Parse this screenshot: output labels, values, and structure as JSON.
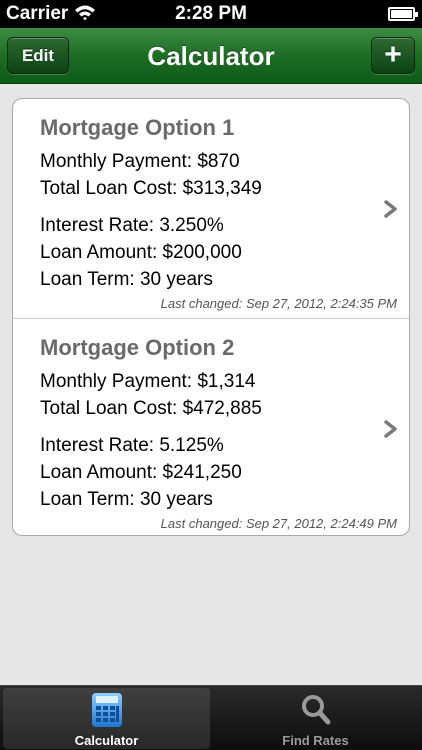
{
  "status_bar": {
    "carrier": "Carrier",
    "time": "2:28 PM",
    "wifi_icon": "wifi-icon",
    "battery_icon": "battery-icon"
  },
  "nav": {
    "title": "Calculator",
    "edit_label": "Edit",
    "add_label": "+"
  },
  "options": [
    {
      "title": "Mortgage Option 1",
      "monthly_payment": "Monthly Payment: $870",
      "total_cost": "Total Loan Cost: $313,349",
      "interest_rate": "Interest Rate: 3.250%",
      "loan_amount": "Loan Amount: $200,000",
      "loan_term": "Loan Term: 30 years",
      "last_changed": "Last changed: Sep 27, 2012, 2:24:35 PM"
    },
    {
      "title": "Mortgage Option 2",
      "monthly_payment": "Monthly Payment: $1,314",
      "total_cost": "Total Loan Cost: $472,885",
      "interest_rate": "Interest Rate: 5.125%",
      "loan_amount": "Loan Amount: $241,250",
      "loan_term": "Loan Term: 30 years",
      "last_changed": "Last changed: Sep 27, 2012, 2:24:49 PM"
    }
  ],
  "tabs": [
    {
      "label": "Calculator",
      "icon": "calculator-icon",
      "selected": true
    },
    {
      "label": "Find Rates",
      "icon": "magnifier-icon",
      "selected": false
    }
  ],
  "colors": {
    "nav_green": "#1d6e25",
    "calculator_blue": "#2f8fe0"
  }
}
